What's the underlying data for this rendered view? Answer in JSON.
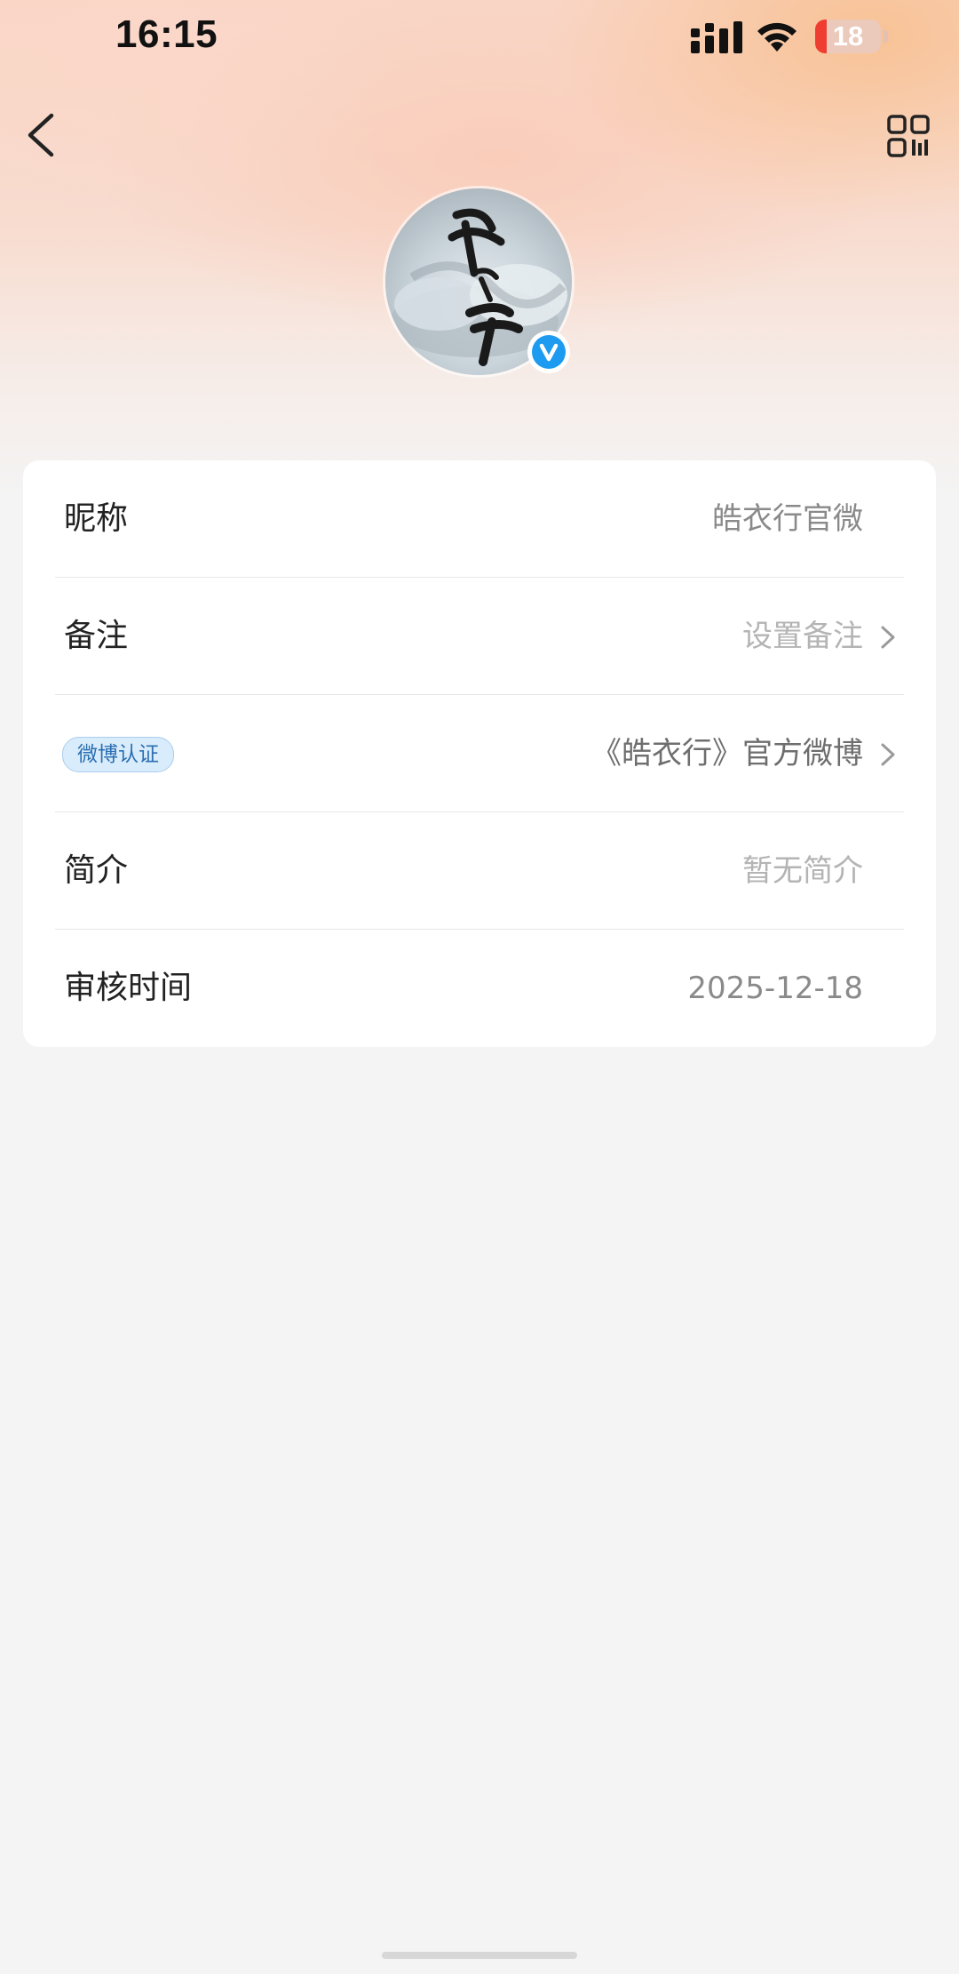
{
  "status_bar": {
    "time": "16:15",
    "battery_level": "18",
    "battery_fraction": 0.18,
    "icons": [
      "signal-icon",
      "wifi-icon",
      "battery-icon"
    ]
  },
  "nav": {
    "back_icon": "chevron-left-icon",
    "qr_icon": "qr-code-icon"
  },
  "profile": {
    "avatar_calligraphy": "皓衣行",
    "verified_icon": "verified-v-icon",
    "verified_color": "#1d9bf0"
  },
  "info_rows": [
    {
      "label": "昵称",
      "value": "皓衣行官微",
      "has_chevron": false
    },
    {
      "label": "备注",
      "value": "设置备注",
      "has_chevron": true
    },
    {
      "badge": "微博认证",
      "value": "《皓衣行》官方微博",
      "has_chevron": true
    },
    {
      "label": "简介",
      "value": "暂无简介",
      "has_chevron": false
    },
    {
      "label": "审核时间",
      "value": "2025-12-18",
      "has_chevron": false
    }
  ]
}
